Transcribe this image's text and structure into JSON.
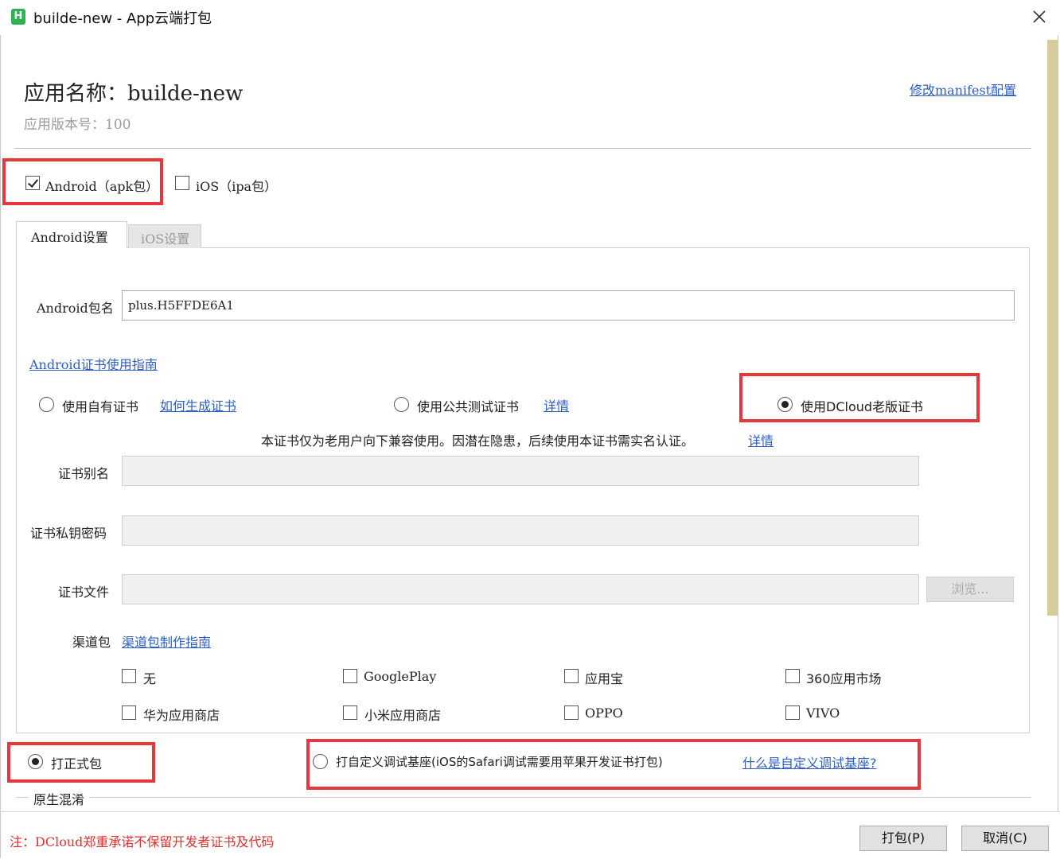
{
  "window": {
    "icon_letter": "H",
    "title": "builde-new - App云端打包",
    "close_glyph": "✕"
  },
  "header": {
    "app_name_label": "应用名称：builde-new",
    "app_version_label": "应用版本号：100",
    "manifest_link": "修改manifest配置"
  },
  "platforms": {
    "android": {
      "label": "Android（apk包）",
      "checked": true
    },
    "ios": {
      "label": "iOS（ipa包）",
      "checked": false
    }
  },
  "tabs": [
    {
      "label": "Android设置",
      "active": true
    },
    {
      "label": "iOS设置",
      "active": false
    }
  ],
  "android": {
    "package_label": "Android包名",
    "package_value": "plus.H5FFDE6A1",
    "cert_guide_link": "Android证书使用指南",
    "cert_options": [
      {
        "label": "使用自有证书",
        "link": "如何生成证书",
        "selected": false
      },
      {
        "label": "使用公共测试证书",
        "link": "详情",
        "selected": false
      },
      {
        "label": "使用DCloud老版证书",
        "selected": true
      }
    ],
    "cert_notice": "本证书仅为老用户向下兼容使用。因潜在隐患，后续使用本证书需实名认证。",
    "cert_notice_link": "详情",
    "cert_alias_label": "证书别名",
    "cert_password_label": "证书私钥密码",
    "cert_file_label": "证书文件",
    "browse_button": "浏览...",
    "channel_label": "渠道包",
    "channel_guide_link": "渠道包制作指南",
    "channels": [
      {
        "label": "无",
        "checked": false
      },
      {
        "label": "GooglePlay",
        "checked": false
      },
      {
        "label": "应用宝",
        "checked": false
      },
      {
        "label": "360应用市场",
        "checked": false
      },
      {
        "label": "华为应用商店",
        "checked": false
      },
      {
        "label": "小米应用商店",
        "checked": false
      },
      {
        "label": "OPPO",
        "checked": false
      },
      {
        "label": "VIVO",
        "checked": false
      }
    ]
  },
  "build_mode": {
    "release_label": "打正式包",
    "release_selected": true,
    "custom_base_label": "打自定义调试基座(iOS的Safari调试需要用苹果开发证书打包)",
    "custom_base_selected": false,
    "custom_base_link": "什么是自定义调试基座?"
  },
  "obfuscation_section": "原生混淆",
  "footer": {
    "note": "注：DCloud郑重承诺不保留开发者证书及代码",
    "pack_button": "打包(P)",
    "cancel_button": "取消(C)"
  },
  "colors": {
    "highlight_border": "#e8363d",
    "link": "#2d5fc4",
    "note": "#e03030",
    "scroll_thumb": "#d6cc9e"
  }
}
